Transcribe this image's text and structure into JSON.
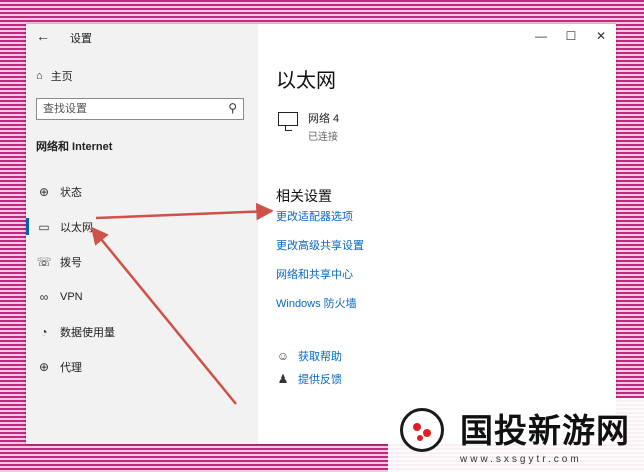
{
  "window": {
    "title": "设置",
    "back_icon": "←",
    "controls": {
      "minimize": "—",
      "maximize": "☐",
      "close": "✕"
    }
  },
  "sidebar": {
    "home_label": "主页",
    "home_icon": "⌂",
    "search_placeholder": "查找设置",
    "search_icon": "⚲",
    "section_title": "网络和 Internet",
    "items": [
      {
        "label": "状态",
        "icon": "⊕",
        "active": false
      },
      {
        "label": "以太网",
        "icon": "▭",
        "active": true
      },
      {
        "label": "拨号",
        "icon": "☏",
        "active": false
      },
      {
        "label": "VPN",
        "icon": "∞",
        "active": false
      },
      {
        "label": "数据使用量",
        "icon": "◔",
        "active": false
      },
      {
        "label": "代理",
        "icon": "⊕",
        "active": false
      }
    ]
  },
  "content": {
    "page_title": "以太网",
    "network": {
      "name": "网络 4",
      "status": "已连接"
    },
    "related_title": "相关设置",
    "links": [
      "更改适配器选项",
      "更改高级共享设置",
      "网络和共享中心",
      "Windows 防火墙"
    ],
    "help": [
      {
        "label": "获取帮助",
        "icon": "☺"
      },
      {
        "label": "提供反馈",
        "icon": "♟"
      }
    ]
  },
  "annotation": {
    "arrow_color": "#d0504a"
  },
  "watermark": {
    "text": "国投新游网",
    "url": "www.sxsgytr.com"
  }
}
